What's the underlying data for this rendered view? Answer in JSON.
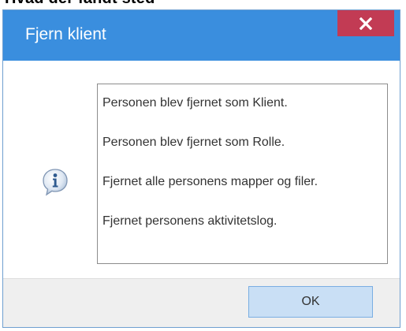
{
  "page_heading_partial": "Hvad der fandt sted",
  "dialog": {
    "title": "Fjern klient",
    "close_icon": "close-x-icon",
    "info_icon": "information-icon",
    "messages": [
      "Personen blev fjernet som Klient.",
      "Personen blev fjernet som Rolle.",
      "Fjernet alle personens mapper og filer.",
      "Fjernet personens aktivitetslog."
    ],
    "ok_label": "OK"
  },
  "colors": {
    "title_bar": "#3a8ede",
    "close_button": "#c23b54",
    "ok_button": "#c9dff5",
    "footer": "#efefef"
  }
}
